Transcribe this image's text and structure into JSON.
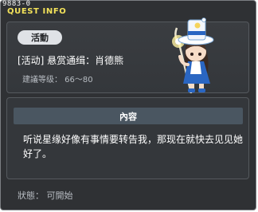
{
  "window": {
    "quest_id": "9883-0",
    "title": "QUEST INFO"
  },
  "quest": {
    "category_tag": "活動",
    "name": "[活动] 悬赏通缉：肖德熊",
    "level_text": "建議等级： 66～80"
  },
  "content": {
    "header": "內容",
    "text": "听说星缘好像有事情要转告我，那现在就快去见见她好了。"
  },
  "footer": {
    "status": "狀態： 可開始"
  },
  "character": {
    "icon": "npc-girl-with-lantern-staff"
  }
}
